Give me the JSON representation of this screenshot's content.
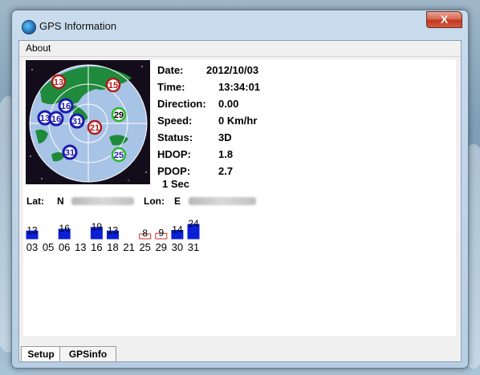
{
  "window": {
    "title": "GPS Information",
    "close_label": "X"
  },
  "menu": {
    "items": [
      "About"
    ]
  },
  "info": {
    "date_label": "Date:",
    "date": "2012/10/03",
    "time_label": "Time:",
    "time": "13:34:01",
    "direction_label": "Direction:",
    "direction": "0.00",
    "speed_label": "Speed:",
    "speed": "0 Km/hr",
    "status_label": "Status:",
    "status": "3D",
    "hdop_label": "HDOP:",
    "hdop": "1.8",
    "pdop_label": "PDOP:",
    "pdop": "2.7",
    "interval": "1 Sec"
  },
  "position": {
    "lat_label": "Lat:",
    "lat_hemi": "N",
    "lon_label": "Lon:",
    "lon_hemi": "E"
  },
  "satellites_sky": [
    {
      "id": "13",
      "status": "tracked"
    },
    {
      "id": "15",
      "status": "tracked"
    },
    {
      "id": "16",
      "status": "used"
    },
    {
      "id": "13",
      "status": "used"
    },
    {
      "id": "16",
      "status": "used"
    },
    {
      "id": "31",
      "status": "used"
    },
    {
      "id": "21",
      "status": "tracked"
    },
    {
      "id": "29",
      "status": "visible"
    },
    {
      "id": "31",
      "status": "used"
    },
    {
      "id": "25",
      "status": "visible"
    }
  ],
  "chart_data": {
    "type": "bar",
    "categories": [
      "03",
      "05",
      "06",
      "13",
      "16",
      "18",
      "21",
      "25",
      "29",
      "30",
      "31"
    ],
    "series": [
      {
        "values": [
          13,
          null,
          16,
          null,
          19,
          13,
          null,
          8,
          9,
          14,
          24
        ]
      }
    ],
    "used_in_fix": [
      true,
      false,
      true,
      false,
      true,
      true,
      false,
      false,
      false,
      true,
      true
    ],
    "colors": {
      "used": "#0a1fd6",
      "unused": "#d62a2a"
    }
  },
  "tabs": [
    {
      "label": "Setup",
      "active": true
    },
    {
      "label": "GPSinfo",
      "active": false
    }
  ]
}
